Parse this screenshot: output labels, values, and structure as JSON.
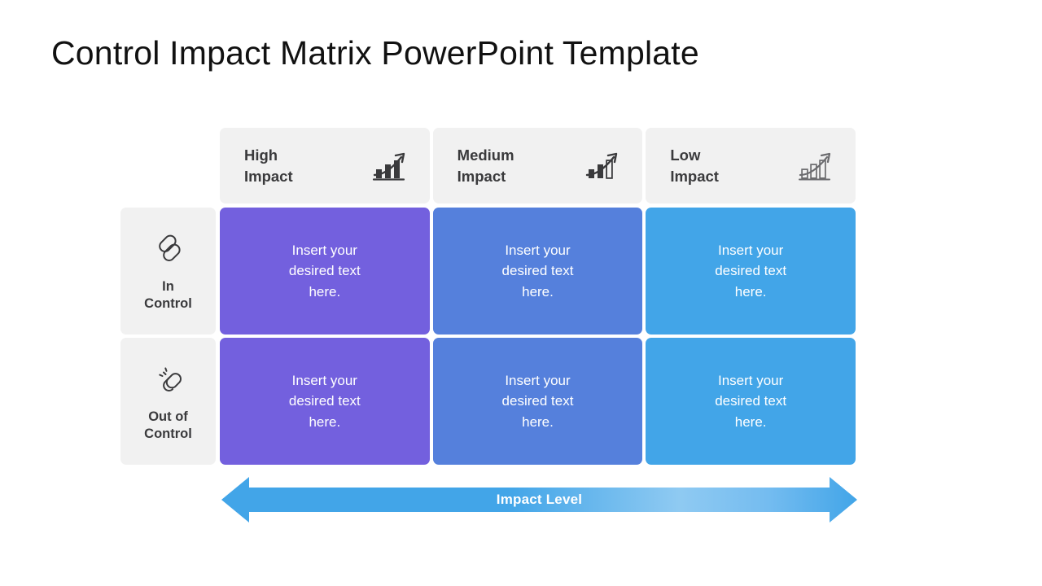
{
  "page": {
    "title": "Control Impact Matrix PowerPoint Template",
    "background": "#ffffff"
  },
  "matrix": {
    "columns": [
      {
        "id": "high-impact",
        "label": "High\nImpact",
        "icon": "bar-chart-growth-icon",
        "icon_filled_bars": 3,
        "cell_color": "#7360DE"
      },
      {
        "id": "medium-impact",
        "label": "Medium\nImpact",
        "icon": "bar-chart-growth-icon",
        "icon_filled_bars": 2,
        "cell_color": "#5580DC"
      },
      {
        "id": "low-impact",
        "label": "Low\nImpact",
        "icon": "bar-chart-growth-icon",
        "icon_filled_bars": 0,
        "cell_color": "#42A5E8"
      }
    ],
    "rows": [
      {
        "id": "in-control",
        "label": "In\nControl",
        "icon": "chain-link-icon"
      },
      {
        "id": "out-of-control",
        "label": "Out of\nControl",
        "icon": "broken-chain-link-icon"
      }
    ],
    "cells": [
      [
        "Insert your\ndesired text\nhere.",
        "Insert your\ndesired text\nhere.",
        "Insert your\ndesired text\nhere."
      ],
      [
        "Insert your\ndesired text\nhere.",
        "Insert your\ndesired text\nhere.",
        "Insert your\ndesired text\nhere."
      ]
    ],
    "header_background": "#f1f1f1",
    "header_text_color": "#3a3a3c",
    "cell_text_color": "#ffffff"
  },
  "impact_arrow": {
    "label": "Impact Level",
    "color_dark": "#42A5E8",
    "color_light": "#8FCAF2",
    "direction": "double"
  }
}
